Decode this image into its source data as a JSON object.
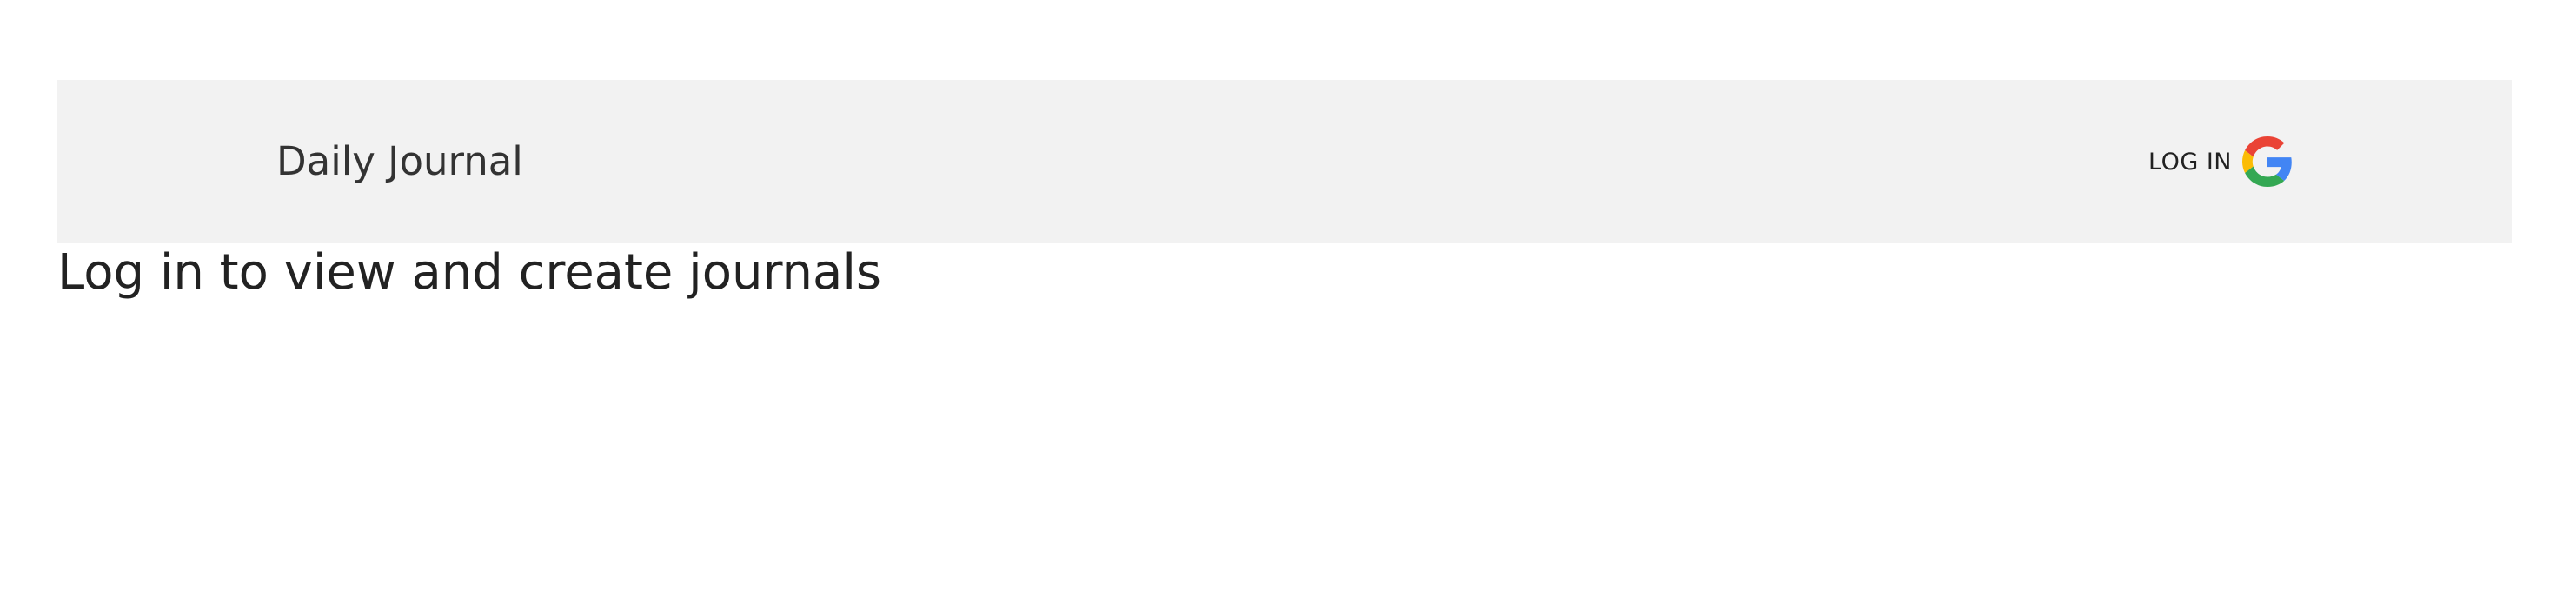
{
  "navbar": {
    "brand": "Daily Journal",
    "login_label": "LOG IN",
    "login_icon": "google-icon"
  },
  "main": {
    "headline": "Log in to view and create journals"
  },
  "colors": {
    "navbar_background": "#f2f2f2",
    "text": "#222222",
    "google_red": "#EA4335",
    "google_yellow": "#FBBC05",
    "google_green": "#34A853",
    "google_blue": "#4285F4"
  }
}
